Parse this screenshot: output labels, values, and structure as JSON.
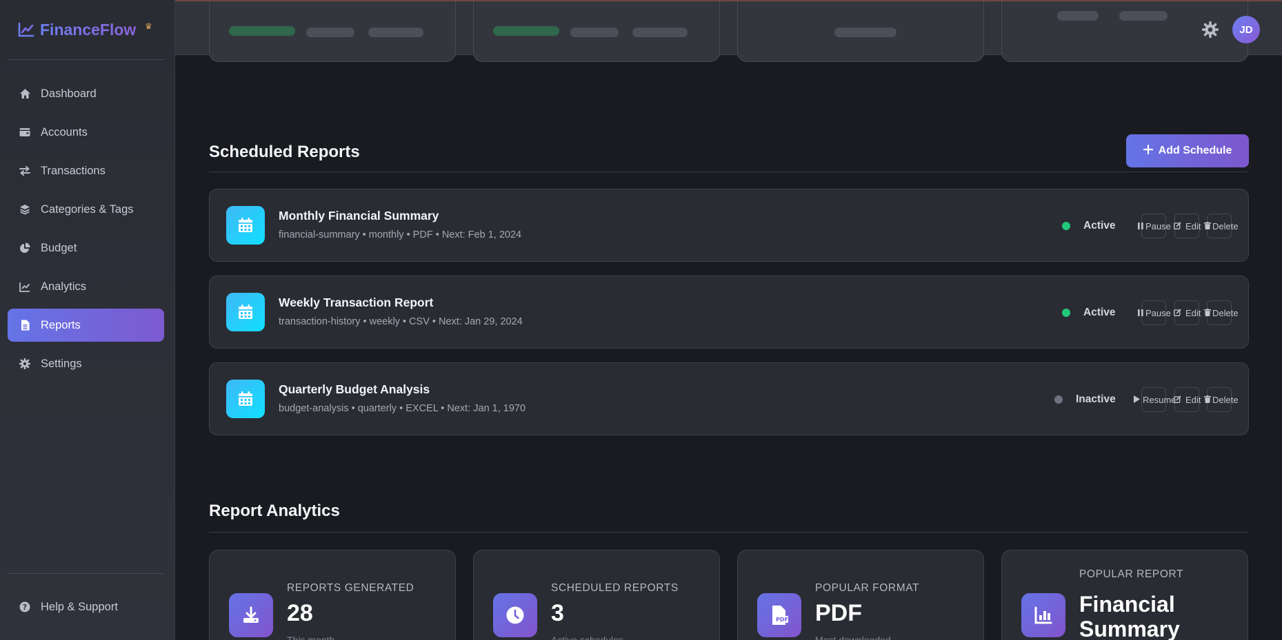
{
  "brand": {
    "name": "FinanceFlow"
  },
  "sidebar": {
    "items": [
      {
        "label": "Dashboard",
        "icon": "home-icon"
      },
      {
        "label": "Accounts",
        "icon": "wallet-icon"
      },
      {
        "label": "Transactions",
        "icon": "swap-icon"
      },
      {
        "label": "Categories & Tags",
        "icon": "layers-icon"
      },
      {
        "label": "Budget",
        "icon": "pie-icon"
      },
      {
        "label": "Analytics",
        "icon": "line-chart-icon"
      },
      {
        "label": "Reports",
        "icon": "document-icon",
        "active": true
      },
      {
        "label": "Settings",
        "icon": "gear-icon"
      }
    ],
    "help": {
      "label": "Help & Support",
      "icon": "question-icon"
    }
  },
  "header": {
    "avatar_initials": "JD"
  },
  "scheduled": {
    "title": "Scheduled Reports",
    "add_label": "Add Schedule",
    "reports": [
      {
        "name": "Monthly Financial Summary",
        "meta": "financial-summary • monthly • PDF • Next: Feb 1, 2024",
        "status": "Active",
        "toggle_label": "Pause",
        "edit_label": "Edit",
        "delete_label": "Delete"
      },
      {
        "name": "Weekly Transaction Report",
        "meta": "transaction-history • weekly • CSV • Next: Jan 29, 2024",
        "status": "Active",
        "toggle_label": "Pause",
        "edit_label": "Edit",
        "delete_label": "Delete"
      },
      {
        "name": "Quarterly Budget Analysis",
        "meta": "budget-analysis • quarterly • EXCEL • Next: Jan 1, 1970",
        "status": "Inactive",
        "toggle_label": "Resume",
        "edit_label": "Edit",
        "delete_label": "Delete"
      }
    ]
  },
  "analytics": {
    "title": "Report Analytics",
    "cards": [
      {
        "label": "REPORTS GENERATED",
        "value": "28",
        "sub": "This month",
        "icon": "download-icon"
      },
      {
        "label": "SCHEDULED REPORTS",
        "value": "3",
        "sub": "Active schedules",
        "icon": "clock-icon"
      },
      {
        "label": "POPULAR FORMAT",
        "value": "PDF",
        "sub": "Most downloaded",
        "icon": "pdf-file-icon"
      },
      {
        "label": "POPULAR REPORT",
        "value_line1": "Financial",
        "value_line2": "Summary",
        "icon": "bar-chart-icon"
      }
    ]
  },
  "colors": {
    "accent_start": "#6474e6",
    "accent_end": "#7d5ad0",
    "active_status": "#22c77a",
    "inactive_status": "#6f7280",
    "calendar_tile": "#1ed6ff"
  }
}
